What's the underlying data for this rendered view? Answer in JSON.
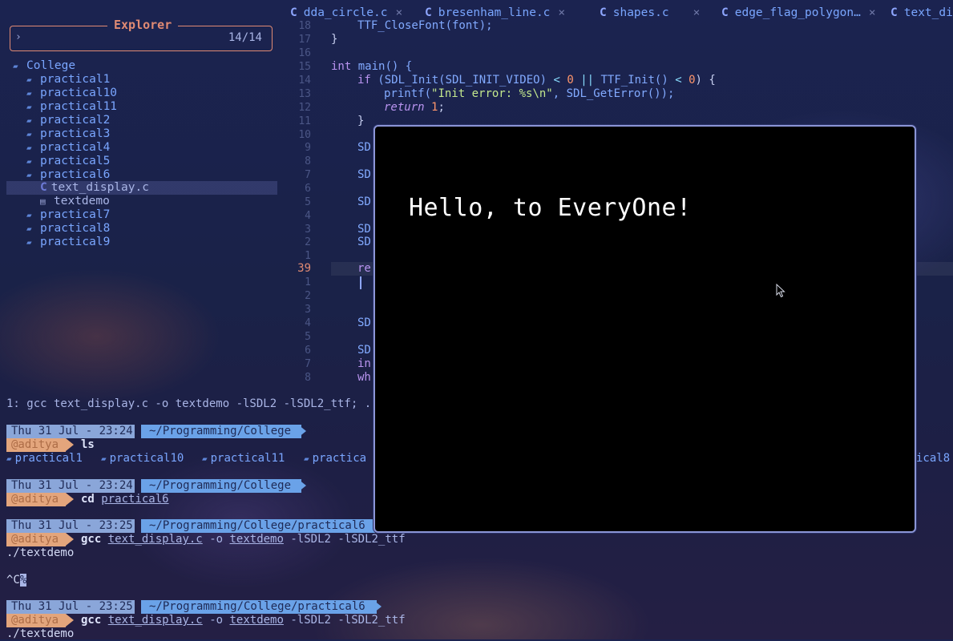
{
  "explorer": {
    "title": "Explorer",
    "prompt": "›",
    "count": "14/14",
    "tree": [
      {
        "label": "College",
        "kind": "folder-open",
        "depth": 0
      },
      {
        "label": "practical1",
        "kind": "folder",
        "depth": 1
      },
      {
        "label": "practical10",
        "kind": "folder",
        "depth": 1
      },
      {
        "label": "practical11",
        "kind": "folder",
        "depth": 1
      },
      {
        "label": "practical2",
        "kind": "folder",
        "depth": 1
      },
      {
        "label": "practical3",
        "kind": "folder",
        "depth": 1
      },
      {
        "label": "practical4",
        "kind": "folder",
        "depth": 1
      },
      {
        "label": "practical5",
        "kind": "folder",
        "depth": 1
      },
      {
        "label": "practical6",
        "kind": "folder-open",
        "depth": 1
      },
      {
        "label": "text_display.c",
        "kind": "c-file",
        "depth": 2,
        "selected": true
      },
      {
        "label": "textdemo",
        "kind": "binary",
        "depth": 2
      },
      {
        "label": "practical7",
        "kind": "folder",
        "depth": 1
      },
      {
        "label": "practical8",
        "kind": "folder",
        "depth": 1
      },
      {
        "label": "practical9",
        "kind": "folder",
        "depth": 1
      }
    ]
  },
  "tabs": [
    {
      "label": "dda_circle.c",
      "close": "×"
    },
    {
      "label": "bresenham_line.c",
      "close": "×"
    },
    {
      "label": "shapes.c",
      "close": "×"
    },
    {
      "label": "edge_flag_polygon…",
      "close": "×"
    },
    {
      "label": "text_di",
      "close": ""
    }
  ],
  "editor": {
    "line_numbers": [
      "18",
      "17",
      "16",
      "15",
      "14",
      "13",
      "12",
      "11",
      "10",
      "9",
      "8",
      "7",
      "6",
      "5",
      "4",
      "3",
      "2",
      "1",
      "39",
      "1",
      "2",
      "3",
      "4",
      "5",
      "6",
      "7",
      "8"
    ],
    "current_line": "39",
    "code": {
      "l18": "TTF_CloseFont(font);",
      "l17": "}",
      "l15a": "int",
      "l15b": " main() {",
      "l14a": "if",
      "l14b": " (SDL_Init(SDL_INIT_VIDEO) ",
      "l14c": "<",
      "l14d": "0",
      "l14e": "||",
      "l14f": " TTF_Init() ",
      "l14g": "<",
      "l14h": "0",
      "l14i": ") {",
      "l13a": "printf(",
      "l13b": "\"Init error: %s\\n\"",
      "l13c": ", SDL_GetError());",
      "l12a": "return",
      "l12b": "1",
      "l12c": ";",
      "l11": "}",
      "l9": "SD",
      "l8": "SD",
      "l6": "SD",
      "l4": "SD",
      "l3": "SD",
      "l39": "re",
      "r4": "SD",
      "r6": "SD",
      "r7": "in",
      "r8": "wh"
    }
  },
  "terminal": {
    "status": "1: gcc text_display.c -o textdemo -lSDL2 -lSDL2_ttf; .",
    "prompts": [
      {
        "date": "Thu 31 Jul - 23:24",
        "path": "~/Programming/College",
        "user": "@aditya",
        "command": "ls"
      },
      {
        "date": "Thu 31 Jul - 23:24",
        "path": "~/Programming/College",
        "user": "@aditya",
        "command": "cd",
        "arg": "practical6"
      },
      {
        "date": "Thu 31 Jul - 23:25",
        "path": "~/Programming/College/practical6",
        "user": "@aditya",
        "command": "gcc",
        "args": [
          "text_display.c",
          "-o",
          "textdemo",
          "-lSDL2 -lSDL2_ttf"
        ]
      },
      {
        "date": "Thu 31 Jul - 23:25",
        "path": "~/Programming/College/practical6",
        "user": "@aditya",
        "command": "gcc",
        "args": [
          "text_display.c",
          "-o",
          "textdemo",
          "-lSDL2 -lSDL2_ttf"
        ]
      }
    ],
    "ls_output": [
      "practical1",
      "practical10",
      "practical11",
      "practica",
      "ical8"
    ],
    "run_line_1": "./textdemo",
    "interrupt": "^C",
    "interrupt_mark": "%",
    "run_line_2": "./textdemo"
  },
  "sdl_window": {
    "text": "Hello, to EveryOne!"
  }
}
